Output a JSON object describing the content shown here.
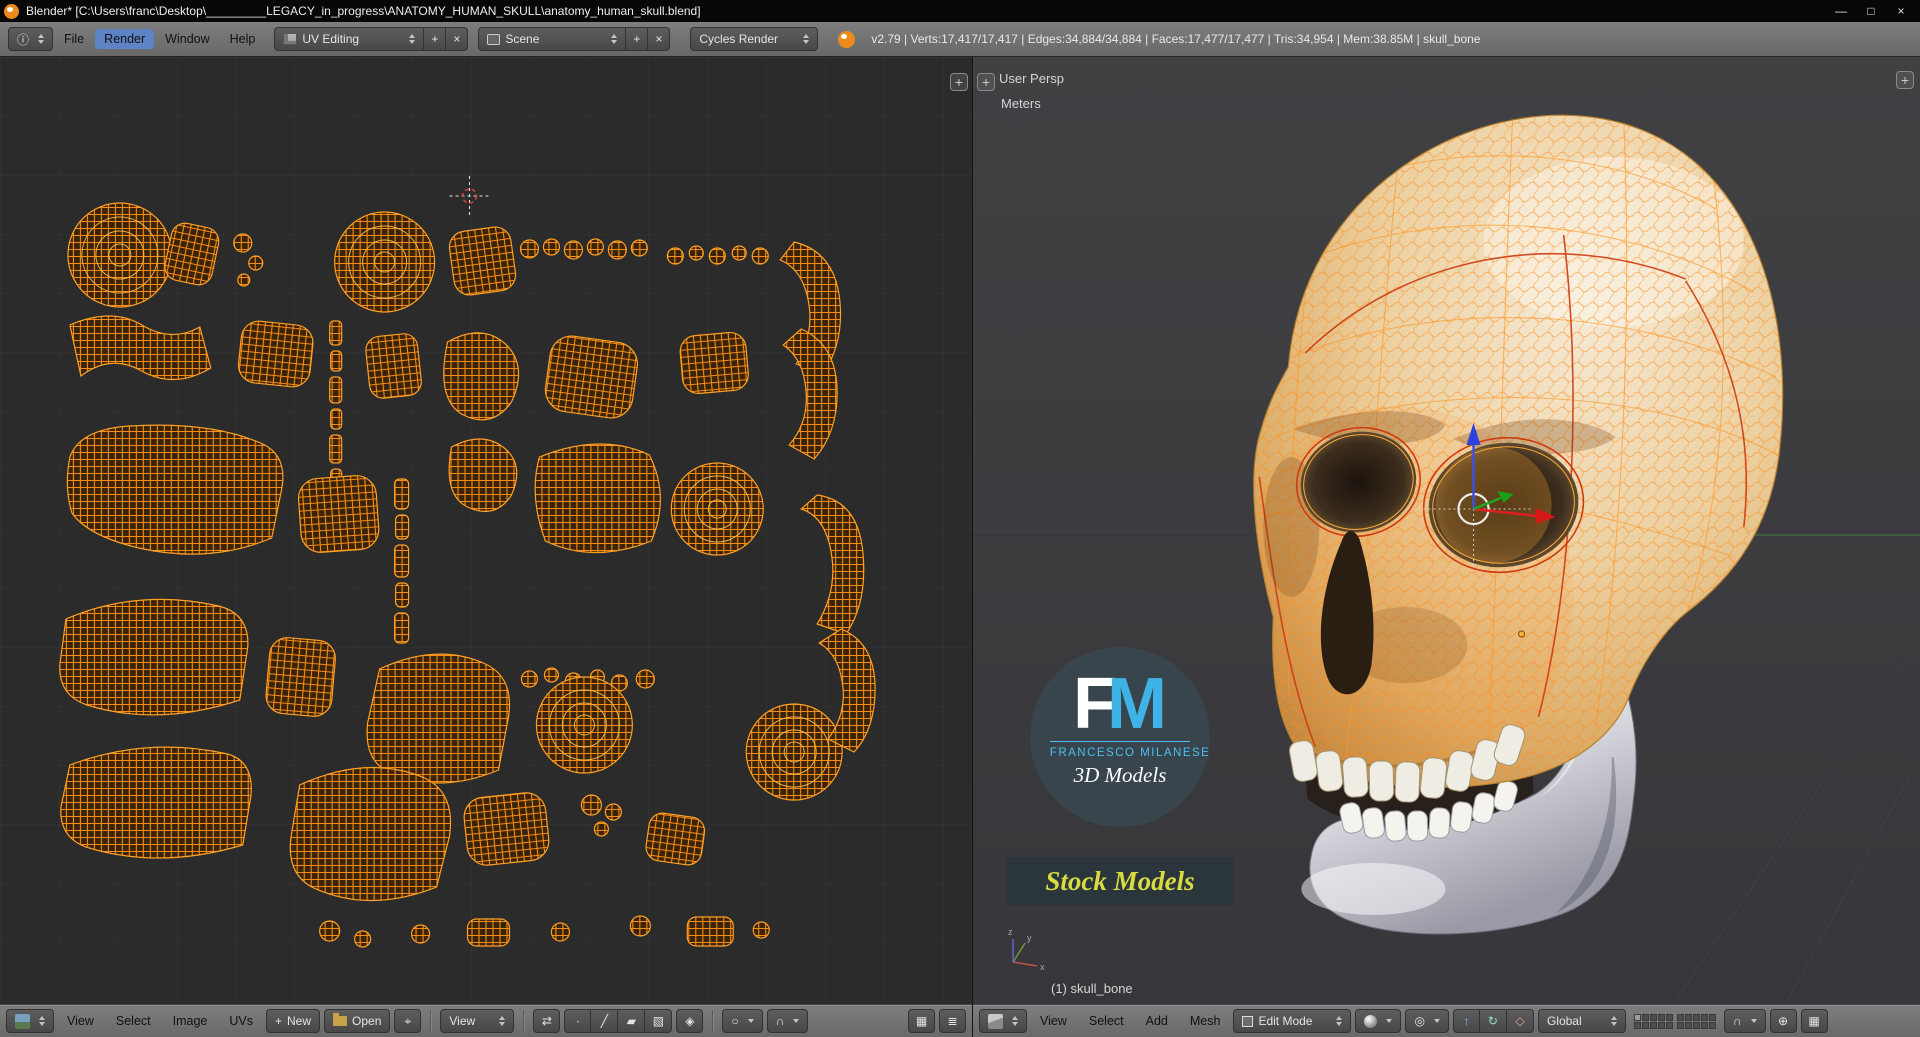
{
  "titlebar": {
    "title": "Blender* [C:\\Users\\franc\\Desktop\\_________LEGACY_in_progress\\ANATOMY_HUMAN_SKULL\\anatomy_human_skull.blend]"
  },
  "top_header": {
    "menus": [
      "File",
      "Render",
      "Window",
      "Help"
    ],
    "active_menu": "Render",
    "layout": {
      "value": "UV Editing"
    },
    "scene": {
      "value": "Scene"
    },
    "engine": {
      "value": "Cycles Render"
    },
    "stats": "v2.79 | Verts:17,417/17,417 | Edges:34,884/34,884 | Faces:17,477/17,477 | Tris:34,954 | Mem:38.85M | skull_bone"
  },
  "uv_editor": {
    "header": {
      "menus": [
        "View",
        "Select",
        "Image",
        "UVs"
      ],
      "new_label": "New",
      "open_label": "Open",
      "view_dropdown": "View"
    }
  },
  "viewport": {
    "view_name": "User Persp",
    "units": "Meters",
    "object_info": "(1) skull_bone",
    "header": {
      "menus": [
        "View",
        "Select",
        "Add",
        "Mesh"
      ],
      "mode": "Edit Mode",
      "orientation": "Global"
    },
    "watermark": {
      "f": "F",
      "m": "M",
      "name": "FRANCESCO MILANESE",
      "line2": "3D Models",
      "banner": "Stock Models"
    }
  },
  "icons": {
    "minimize": "—",
    "maximize": "□",
    "close": "×",
    "plus": "+",
    "x": "×",
    "info": "ⓘ",
    "pin": "⌖",
    "sync": "⇄",
    "vertex_select": "∙",
    "edge_select": "╱",
    "face_select": "▰",
    "island_select": "▧",
    "sticky": "◈",
    "proportional": "○",
    "magnet": "∩",
    "pivot": "◎",
    "cursor": "⊕",
    "translate": "↑",
    "rotate": "↻",
    "scale": "◇",
    "grid": "▦",
    "list": "≣"
  },
  "colors": {
    "accent_orange": "#ff9d2a",
    "seam_red": "#cf3a10",
    "selection_blue": "#5d83c4",
    "fm_blue": "#3fb3e6",
    "banner_yellow": "#d8dc3e"
  }
}
